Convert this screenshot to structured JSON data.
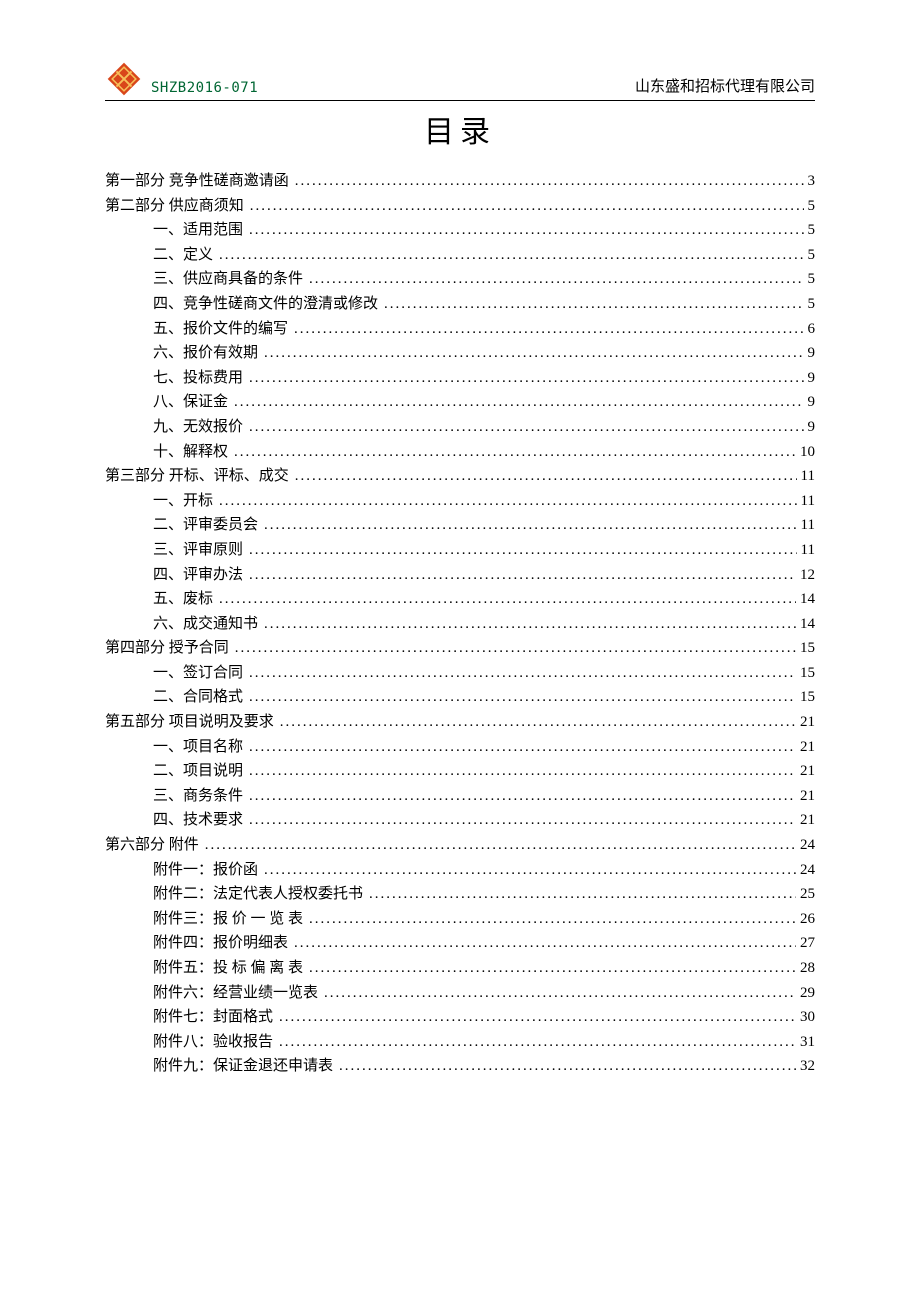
{
  "header": {
    "doc_code": "SHZB2016-071",
    "company": "山东盛和招标代理有限公司"
  },
  "title": "目录",
  "toc": [
    {
      "level": 1,
      "label": "第一部分  竞争性磋商邀请函",
      "page": "3"
    },
    {
      "level": 1,
      "label": "第二部分  供应商须知",
      "page": "5"
    },
    {
      "level": 2,
      "label": "一、适用范围",
      "page": "5"
    },
    {
      "level": 2,
      "label": "二、定义",
      "page": "5"
    },
    {
      "level": 2,
      "label": "三、供应商具备的条件",
      "page": "5"
    },
    {
      "level": 2,
      "label": "四、竞争性磋商文件的澄清或修改",
      "page": "5"
    },
    {
      "level": 2,
      "label": "五、报价文件的编写",
      "page": "6"
    },
    {
      "level": 2,
      "label": "六、报价有效期",
      "page": "9"
    },
    {
      "level": 2,
      "label": "七、投标费用",
      "page": "9"
    },
    {
      "level": 2,
      "label": "八、保证金",
      "page": "9"
    },
    {
      "level": 2,
      "label": "九、无效报价",
      "page": "9"
    },
    {
      "level": 2,
      "label": "十、解释权",
      "page": "10"
    },
    {
      "level": 1,
      "label": "第三部分  开标、评标、成交",
      "page": "11"
    },
    {
      "level": 2,
      "label": "一、开标",
      "page": "11"
    },
    {
      "level": 2,
      "label": "二、评审委员会",
      "page": "11"
    },
    {
      "level": 2,
      "label": "三、评审原则",
      "page": "11"
    },
    {
      "level": 2,
      "label": "四、评审办法",
      "page": "12"
    },
    {
      "level": 2,
      "label": "五、废标",
      "page": "14"
    },
    {
      "level": 2,
      "label": "六、成交通知书",
      "page": "14"
    },
    {
      "level": 1,
      "label": "第四部分  授予合同",
      "page": "15"
    },
    {
      "level": 2,
      "label": "一、签订合同",
      "page": "15"
    },
    {
      "level": 2,
      "label": "二、合同格式",
      "page": "15"
    },
    {
      "level": 1,
      "label": "第五部分  项目说明及要求",
      "page": "21"
    },
    {
      "level": 2,
      "label": "一、项目名称",
      "page": "21"
    },
    {
      "level": 2,
      "label": "二、项目说明",
      "page": "21"
    },
    {
      "level": 2,
      "label": "三、商务条件",
      "page": "21"
    },
    {
      "level": 2,
      "label": "四、技术要求",
      "page": "21"
    },
    {
      "level": 1,
      "label": "第六部分    附件",
      "page": "24"
    },
    {
      "level": 2,
      "label": "附件一：报价函",
      "page": "24"
    },
    {
      "level": 2,
      "label": "附件二：法定代表人授权委托书",
      "page": "25"
    },
    {
      "level": 2,
      "label": "附件三：报  价 一 览 表",
      "page": "26"
    },
    {
      "level": 2,
      "label": "附件四：报价明细表",
      "page": "27"
    },
    {
      "level": 2,
      "label": "附件五：投 标 偏 离 表",
      "page": "28"
    },
    {
      "level": 2,
      "label": "附件六：经营业绩一览表",
      "page": "29"
    },
    {
      "level": 2,
      "label": "附件七：封面格式",
      "page": "30"
    },
    {
      "level": 2,
      "label": "附件八：验收报告",
      "page": "31"
    },
    {
      "level": 2,
      "label": "附件九：保证金退还申请表",
      "page": "32"
    }
  ]
}
